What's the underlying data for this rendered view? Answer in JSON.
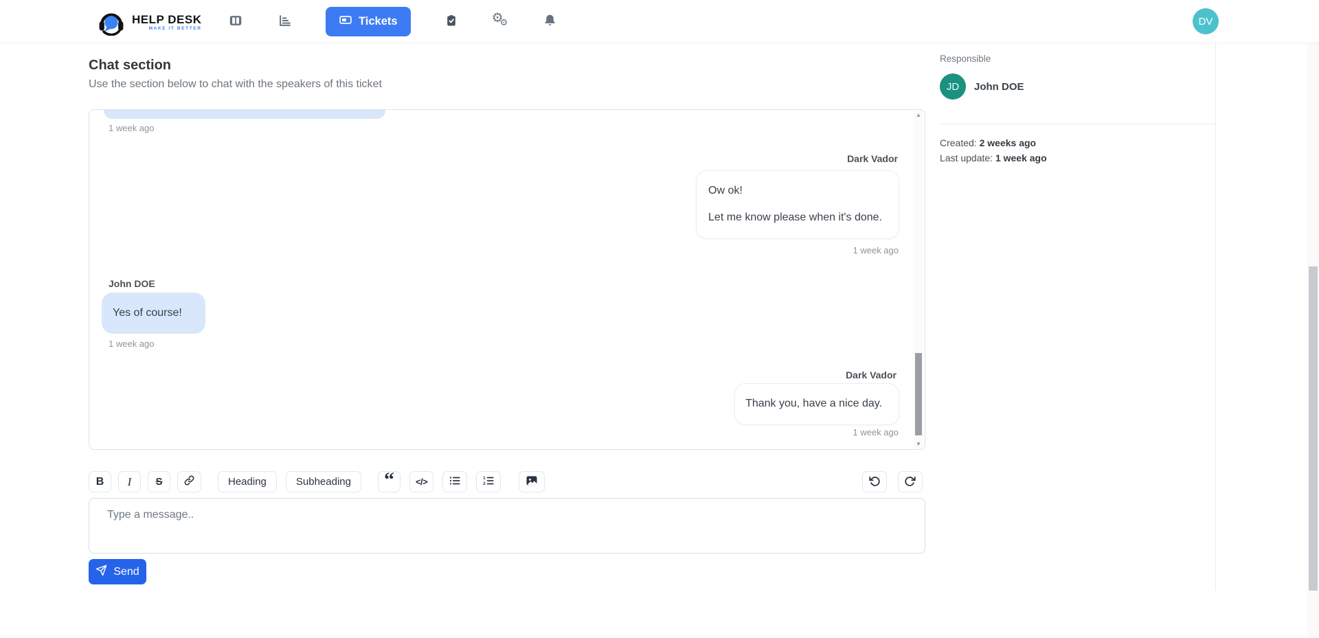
{
  "brand": {
    "name": "HELP DESK",
    "tagline": "MAKE IT BETTER"
  },
  "nav": {
    "tickets_label": "Tickets"
  },
  "user": {
    "initials": "DV",
    "avatar_color": "#4cc3cc"
  },
  "page": {
    "title": "Chat section",
    "subtitle": "Use the section below to chat with the speakers of this ticket"
  },
  "chat": {
    "messages": [
      {
        "sender": "",
        "side": "left",
        "partial": true,
        "timestamp": "1 week ago"
      },
      {
        "sender": "Dark Vador",
        "side": "right",
        "lines": [
          "Ow ok!",
          "Let me know please when it's done."
        ],
        "timestamp": "1 week ago"
      },
      {
        "sender": "John DOE",
        "side": "left",
        "lines": [
          "Yes of course!"
        ],
        "timestamp": "1 week ago"
      },
      {
        "sender": "Dark Vador",
        "side": "right",
        "lines": [
          "Thank you, have a nice day."
        ],
        "timestamp": "1 week ago"
      }
    ]
  },
  "details": {
    "responsible_label": "Responsible",
    "responsible_initials": "JD",
    "responsible_name": "John DOE",
    "responsible_avatar_color": "#1b9180",
    "created_label": "Created:",
    "created_value": "2 weeks ago",
    "last_update_label": "Last update:",
    "last_update_value": "1 week ago"
  },
  "editor": {
    "bold_label": "B",
    "italic_label": "I",
    "strike_label": "S",
    "heading_label": "Heading",
    "subheading_label": "Subheading",
    "quote_glyph": "“",
    "code_label": "</>",
    "placeholder": "Type a message..",
    "send_label": "Send",
    "gear_glyph": "⚙"
  },
  "colors": {
    "primary_button": "#3d7bf4",
    "send_button": "#2563eb",
    "bubble_left": "#d8e7fb"
  }
}
